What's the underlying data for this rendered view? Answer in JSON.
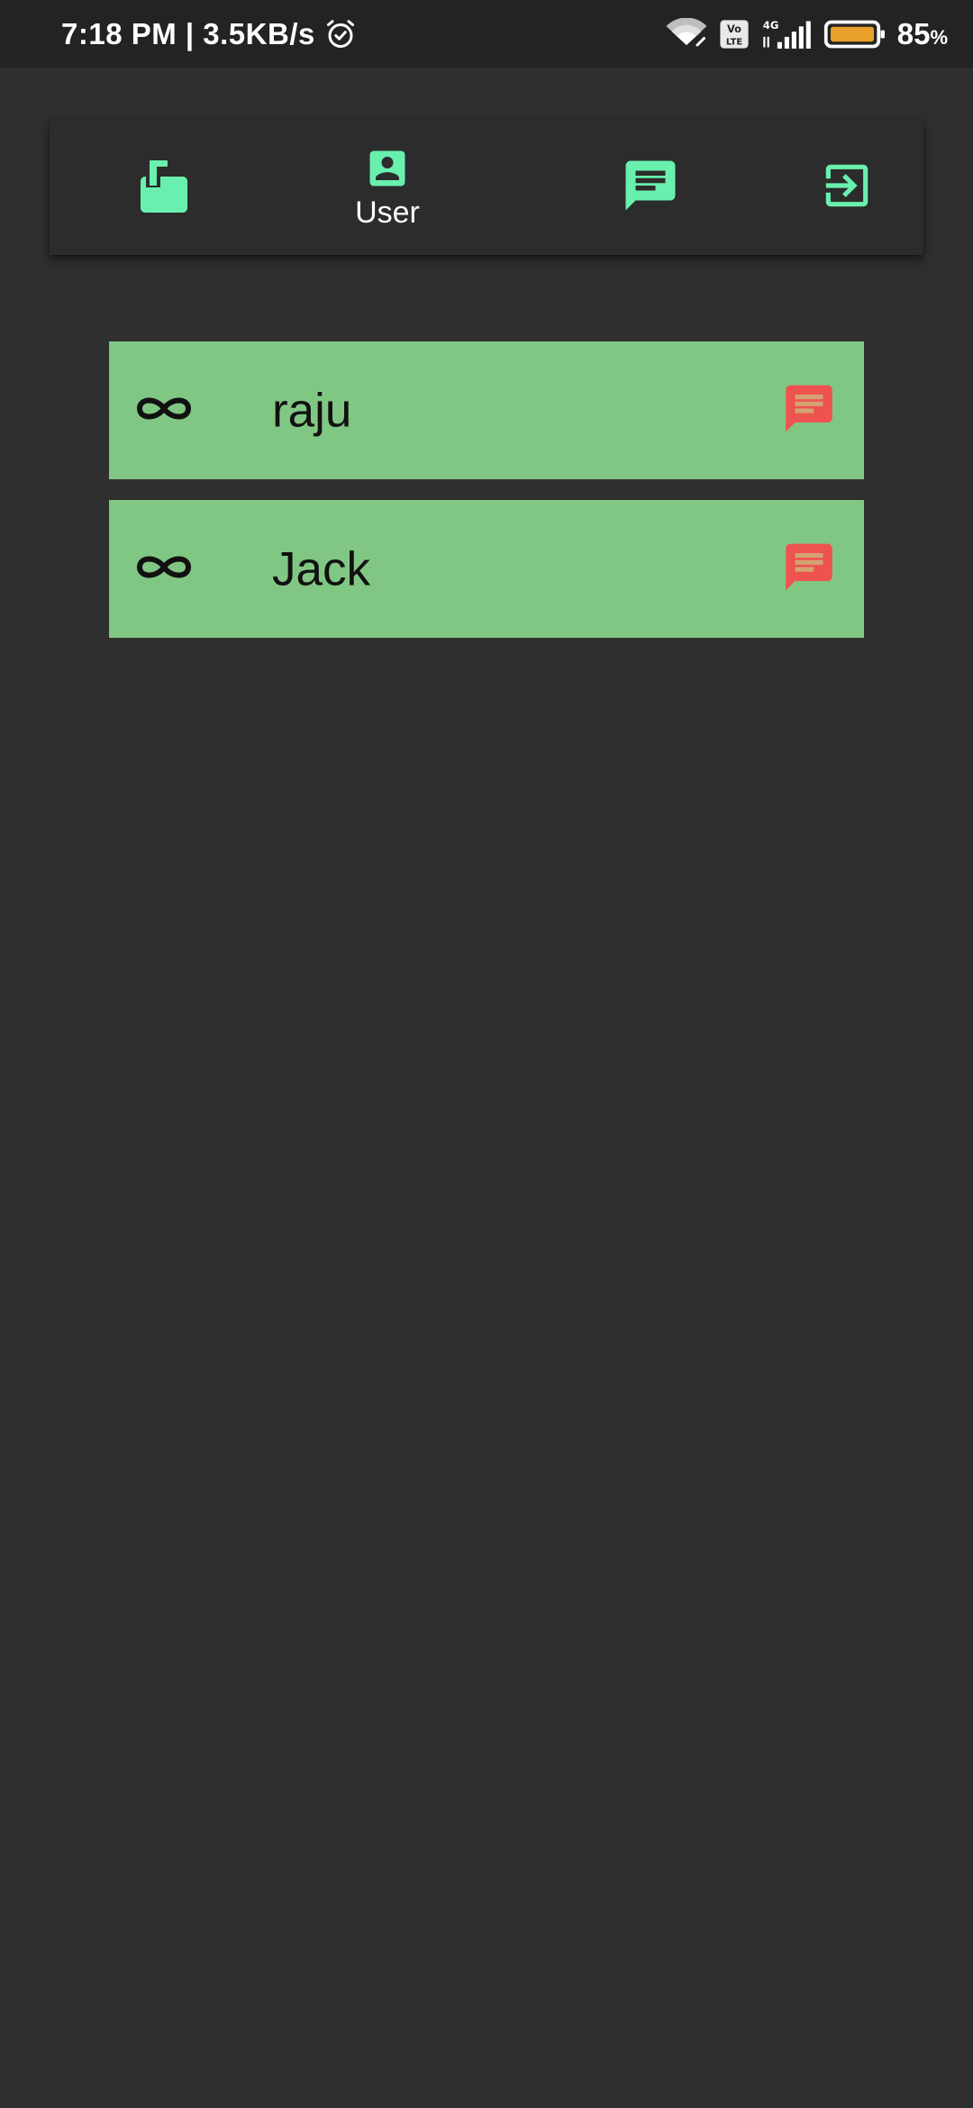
{
  "status_bar": {
    "time_speed": "7:18 PM | 3.5KB/s",
    "battery_percent": "85",
    "battery_unit": "%",
    "battery_level": 0.85,
    "icons": [
      "alarm-icon",
      "wifi-icon",
      "volte-icon",
      "signal-4g-icon",
      "battery-icon"
    ]
  },
  "nav": {
    "items": [
      {
        "icon": "mailbox-icon",
        "label": ""
      },
      {
        "icon": "account-box-icon",
        "label": "User"
      },
      {
        "icon": "chat-icon",
        "label": ""
      },
      {
        "icon": "exit-to-app-icon",
        "label": ""
      }
    ],
    "accent_color": "#69f0ae"
  },
  "users": [
    {
      "name": "raju",
      "icon": "infinity-icon",
      "action_icon": "chat-icon"
    },
    {
      "name": "Jack",
      "icon": "infinity-icon",
      "action_icon": "chat-icon"
    }
  ],
  "colors": {
    "background": "#2f2f2f",
    "status_bar": "#232323",
    "nav_card": "#2c2c2c",
    "list_item": "#81c784",
    "chat_action": "#ef5350",
    "battery_fill": "#e8a02a"
  }
}
